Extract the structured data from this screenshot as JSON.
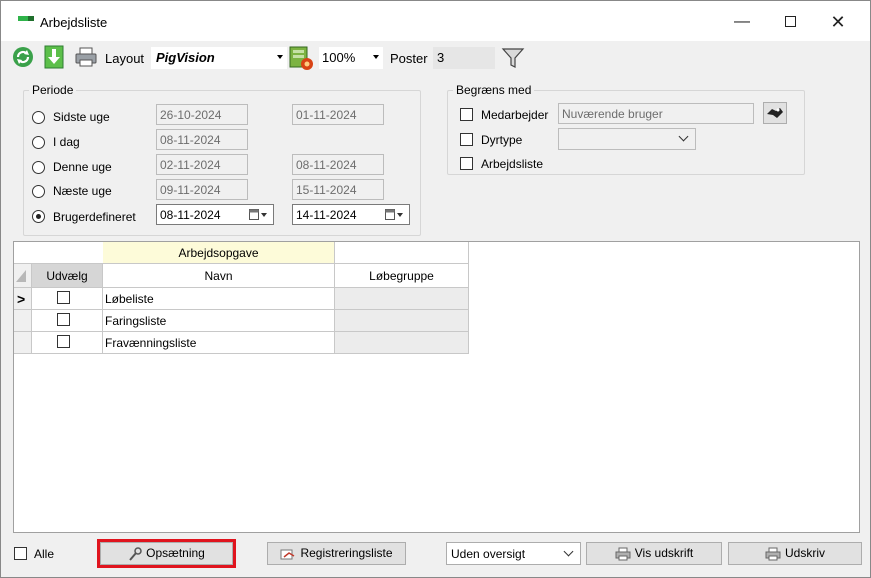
{
  "window": {
    "title": "Arbejdsliste",
    "controls": [
      "minimize",
      "maximize",
      "close"
    ],
    "minimize_glyph": "—",
    "close_glyph": "✕"
  },
  "toolbar": {
    "layout_label": "Layout",
    "layout_value": "PigVision",
    "zoom_value": "100%",
    "poster_label": "Poster",
    "poster_value": "3",
    "icons": [
      "refresh-icon",
      "download-arrow-icon",
      "printer-icon",
      "layout-settings-icon",
      "filter-icon"
    ]
  },
  "periode": {
    "legend": "Periode",
    "options": [
      {
        "label": "Sidste uge",
        "from": "26-10-2024",
        "to": "01-11-2024",
        "selected": false
      },
      {
        "label": "I dag",
        "from": "08-11-2024",
        "to": "",
        "selected": false
      },
      {
        "label": "Denne uge",
        "from": "02-11-2024",
        "to": "08-11-2024",
        "selected": false
      },
      {
        "label": "Næste uge",
        "from": "09-11-2024",
        "to": "15-11-2024",
        "selected": false
      },
      {
        "label": "Brugerdefineret",
        "from": "08-11-2024",
        "to": "14-11-2024",
        "selected": true
      }
    ]
  },
  "begraens": {
    "legend": "Begræns med",
    "medarbejder_label": "Medarbejder",
    "medarbejder_value": "Nuværende bruger",
    "dyrtype_label": "Dyrtype",
    "dyrtype_value": "",
    "arbejdsliste_label": "Arbejdsliste"
  },
  "grid": {
    "band_header": "Arbejdsopgave",
    "columns": [
      "Udvælg",
      "Navn",
      "Løbegruppe"
    ],
    "current_row_marker": ">",
    "rows": [
      {
        "selected": false,
        "navn": "Løbeliste",
        "lobegruppe": ""
      },
      {
        "selected": false,
        "navn": "Faringsliste",
        "lobegruppe": ""
      },
      {
        "selected": false,
        "navn": "Fravænningsliste",
        "lobegruppe": ""
      }
    ]
  },
  "bottom": {
    "alle_label": "Alle",
    "opsaetning_label": "Opsætning",
    "registreringsliste_label": "Registreringsliste",
    "oversigt_value": "Uden oversigt",
    "vis_udskrift_label": "Vis udskrift",
    "udskriv_label": "Udskriv",
    "highlight_color": "#e0141e"
  }
}
